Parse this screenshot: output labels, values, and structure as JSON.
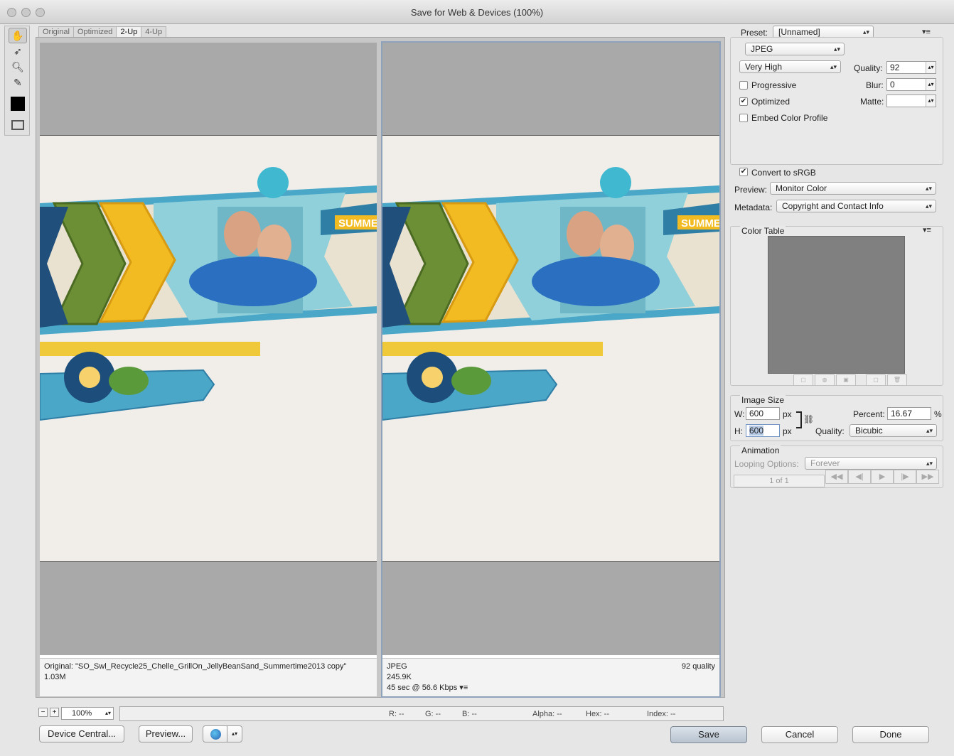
{
  "window": {
    "title": "Save for Web & Devices (100%)"
  },
  "tabs": [
    "Original",
    "Optimized",
    "2-Up",
    "4-Up"
  ],
  "active_tab": "2-Up",
  "tools": [
    "hand-tool",
    "slice-select-tool",
    "zoom-tool",
    "eyedropper-tool",
    "eyedropper-color",
    "toggle-slices"
  ],
  "panes": {
    "original": {
      "line1": "Original: \"SO_Swl_Recycle25_Chelle_GrillOn_JellyBeanSand_Summertime2013 copy\"",
      "line2": "1.03M",
      "banner": "SUMMER"
    },
    "optimized": {
      "format": "JPEG",
      "quality_text": "92 quality",
      "size": "245.9K",
      "time": "45 sec @ 56.6 Kbps",
      "banner": "SUMMER"
    }
  },
  "zoom": {
    "value": "100%"
  },
  "readout": {
    "r": "R: --",
    "g": "G: --",
    "b": "B: --",
    "alpha": "Alpha: --",
    "hex": "Hex: --",
    "index": "Index: --"
  },
  "buttons": {
    "device_central": "Device Central...",
    "preview": "Preview...",
    "save": "Save",
    "cancel": "Cancel",
    "done": "Done"
  },
  "settings": {
    "preset_label": "Preset:",
    "preset_value": "[Unnamed]",
    "format": "JPEG",
    "quality_preset": "Very High",
    "quality_label": "Quality:",
    "quality_value": "92",
    "progressive_label": "Progressive",
    "progressive": false,
    "blur_label": "Blur:",
    "blur_value": "0",
    "optimized_label": "Optimized",
    "optimized": true,
    "matte_label": "Matte:",
    "embed_label": "Embed Color Profile",
    "embed": false,
    "srgb_label": "Convert to sRGB",
    "srgb": true,
    "preview_label": "Preview:",
    "preview_value": "Monitor Color",
    "metadata_label": "Metadata:",
    "metadata_value": "Copyright and Contact Info"
  },
  "color_table": {
    "title": "Color Table"
  },
  "image_size": {
    "title": "Image Size",
    "w_label": "W:",
    "w_value": "600",
    "h_label": "H:",
    "h_value": "600",
    "unit": "px",
    "percent_label": "Percent:",
    "percent_value": "16.67",
    "percent_unit": "%",
    "quality_label": "Quality:",
    "quality_value": "Bicubic"
  },
  "animation": {
    "title": "Animation",
    "looping_label": "Looping Options:",
    "looping_value": "Forever",
    "frame": "1 of 1"
  },
  "colors": {
    "accent_blue": "#4aa7c8",
    "green": "#6c8f36",
    "yellow": "#f2bb22"
  }
}
